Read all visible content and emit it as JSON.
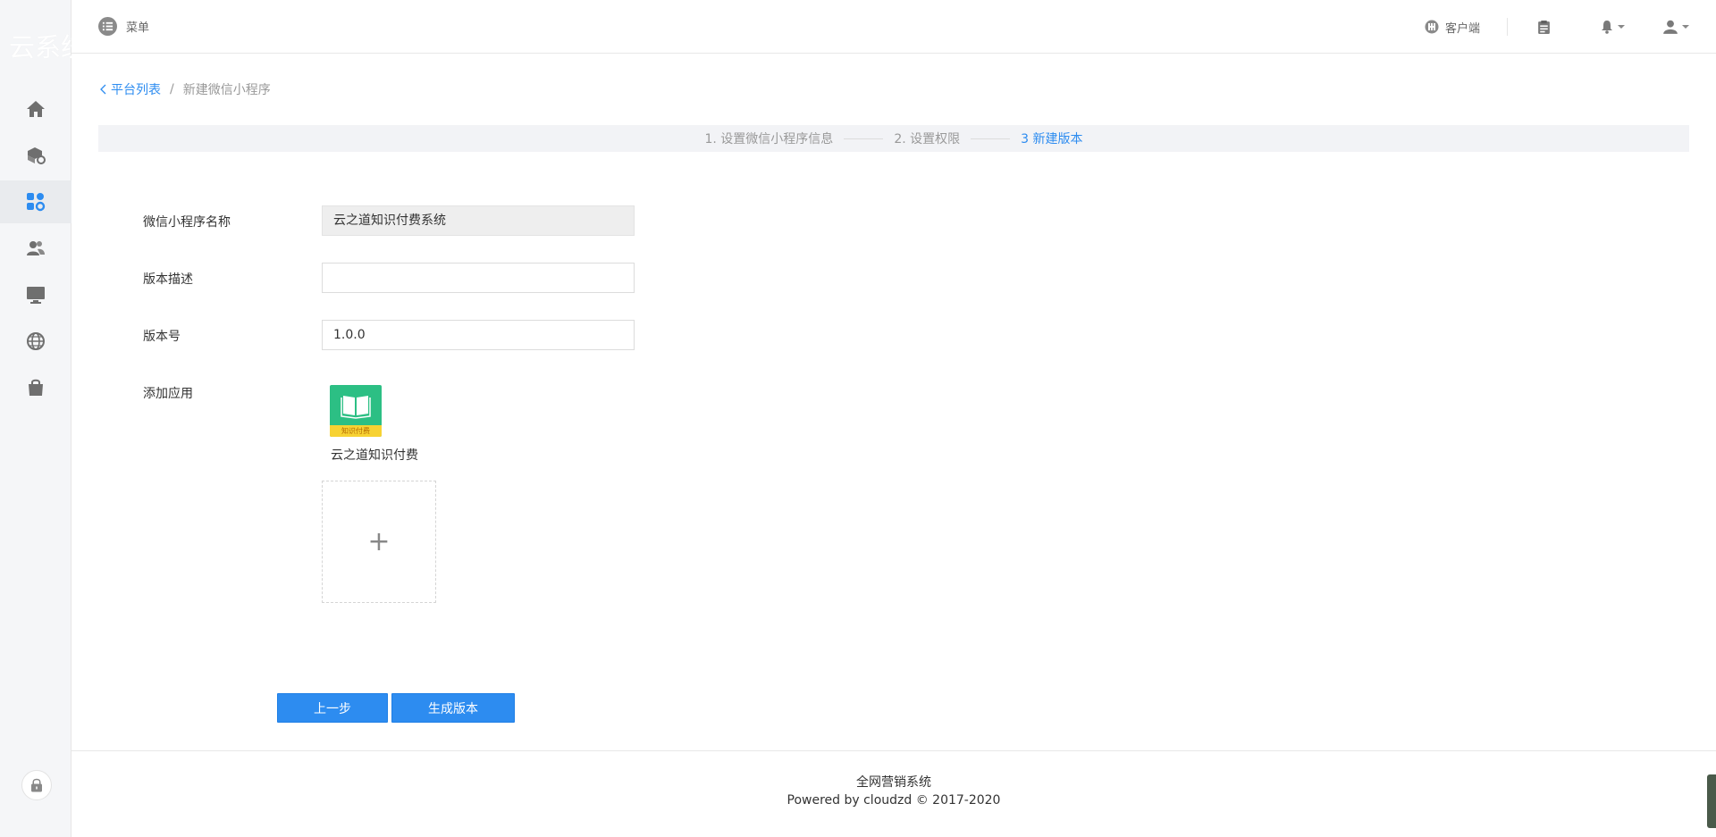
{
  "sidebar": {
    "brand": "云系统",
    "items": [
      {
        "icon": "home-icon",
        "active": false
      },
      {
        "icon": "box-settings-icon",
        "active": false
      },
      {
        "icon": "apps-settings-icon",
        "active": true
      },
      {
        "icon": "users-icon",
        "active": false
      },
      {
        "icon": "monitor-icon",
        "active": false
      },
      {
        "icon": "globe-icon",
        "active": false
      },
      {
        "icon": "shopping-bag-icon",
        "active": false
      }
    ],
    "lock_icon": "lock-icon"
  },
  "header": {
    "menu_label": "菜单",
    "client_label": "客户端"
  },
  "breadcrumb": {
    "back_label": "平台列表",
    "separator": "/",
    "current": "新建微信小程序"
  },
  "steps": [
    {
      "label": "1. 设置微信小程序信息",
      "active": false
    },
    {
      "label": "2. 设置权限",
      "active": false
    },
    {
      "label": "3 新建版本",
      "active": true
    }
  ],
  "form": {
    "name_label": "微信小程序名称",
    "name_value": "云之道知识付费系统",
    "desc_label": "版本描述",
    "desc_value": "",
    "version_label": "版本号",
    "version_value": "1.0.0",
    "apps_label": "添加应用",
    "app": {
      "name": "云之道知识付费",
      "badge": "知识付费"
    },
    "add_symbol": "+"
  },
  "buttons": {
    "prev": "上一步",
    "generate": "生成版本"
  },
  "footer": {
    "line1": "全网营销系统",
    "line2": "Powered by cloudzd © 2017-2020"
  },
  "colors": {
    "accent": "#2d8cf0",
    "app_green": "#2cbf84",
    "app_yellow": "#f7d233"
  }
}
